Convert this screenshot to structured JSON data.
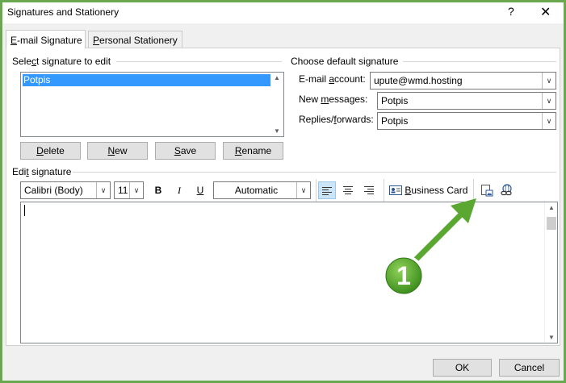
{
  "window": {
    "title": "Signatures and Stationery",
    "help": "?",
    "close": "✕"
  },
  "tabs": [
    {
      "label": "E-mail Signature",
      "accel": "E",
      "rest": "-mail Signature",
      "active": true
    },
    {
      "label": "Personal Stationery",
      "accel": "P",
      "rest": "ersonal Stationery",
      "active": false
    }
  ],
  "select_group": {
    "label_pre": "Sele",
    "label_accel": "c",
    "label_post": "t signature to edit",
    "items": [
      "Potpis"
    ]
  },
  "list_buttons": {
    "delete": {
      "accel": "D",
      "rest": "elete"
    },
    "new": {
      "accel": "N",
      "rest": "ew"
    },
    "save": {
      "accel": "S",
      "rest": "ave"
    },
    "rename": {
      "accel": "R",
      "rest": "ename"
    }
  },
  "default_group": {
    "label": "Choose default signature",
    "email_account": {
      "label_pre": "E-mail ",
      "label_accel": "a",
      "label_post": "ccount:",
      "value": "upute@wmd.hosting"
    },
    "new_messages": {
      "label_pre": "New ",
      "label_accel": "m",
      "label_post": "essages:",
      "value": "Potpis"
    },
    "replies": {
      "label_pre": "Replies/",
      "label_accel": "f",
      "label_post": "orwards:",
      "value": "Potpis"
    }
  },
  "edit_group": {
    "label_pre": "Edi",
    "label_accel": "t",
    "label_post": " signature",
    "font": "Calibri (Body)",
    "size": "11",
    "bold": "B",
    "italic": "I",
    "underline": "U",
    "color": "Automatic",
    "business_card": {
      "accel": "B",
      "rest": "usiness Card"
    }
  },
  "icons": {
    "align_left": "align-left-icon",
    "align_center": "align-center-icon",
    "align_right": "align-right-icon",
    "business_card": "business-card-icon",
    "insert_picture": "insert-picture-icon",
    "hyperlink": "hyperlink-icon"
  },
  "annotation": {
    "number": "1",
    "color": "#5aa831"
  },
  "footer": {
    "ok": "OK",
    "cancel": "Cancel"
  },
  "colors": {
    "selection": "#3399ff",
    "border_accent": "#6aa84f"
  }
}
